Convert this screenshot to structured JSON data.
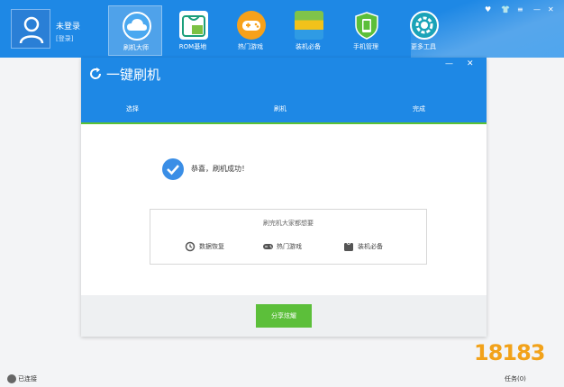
{
  "user": {
    "name": "未登录",
    "login": "[登录]"
  },
  "nav": [
    {
      "label": "刷机大师",
      "icon": "cloud-icon",
      "active": true
    },
    {
      "label": "ROM基地",
      "icon": "rom-bag-icon",
      "active": false
    },
    {
      "label": "热门游戏",
      "icon": "gamepad-icon",
      "active": false
    },
    {
      "label": "装机必备",
      "icon": "apps-stack-icon",
      "active": false
    },
    {
      "label": "手机管理",
      "icon": "phone-shield-icon",
      "active": false
    },
    {
      "label": "更多工具",
      "icon": "tools-gear-icon",
      "active": false
    }
  ],
  "window_controls": [
    "heart-icon",
    "shirt-icon",
    "menu-icon",
    "minimize-icon",
    "close-icon"
  ],
  "dialog": {
    "title": "一键刷机",
    "steps": [
      "选择",
      "刷机",
      "完成"
    ],
    "success_text": "恭喜，刷机成功！",
    "recommend": {
      "title": "刷完机大家都想要",
      "items": [
        {
          "label": "数据恢复",
          "icon": "data-restore-icon"
        },
        {
          "label": "热门游戏",
          "icon": "gamepad-icon"
        },
        {
          "label": "装机必备",
          "icon": "apps-bag-icon"
        }
      ]
    },
    "share_button": "分享炫耀"
  },
  "status": {
    "connected": "已连接",
    "tasks": "任务(0)"
  },
  "watermark": "18183",
  "colors": {
    "primary": "#1e88e5",
    "success_green": "#5cbf3a",
    "watermark": "#f2a21a"
  }
}
